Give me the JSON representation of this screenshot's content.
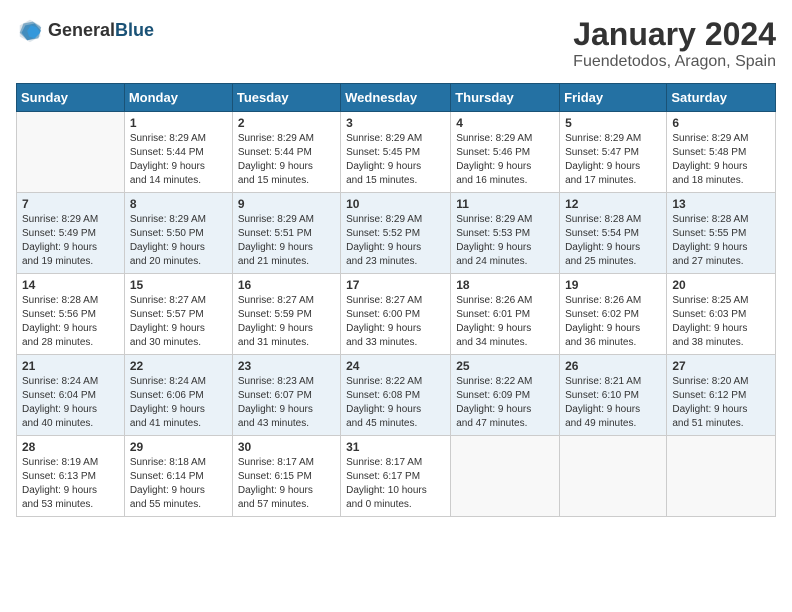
{
  "header": {
    "logo_general": "General",
    "logo_blue": "Blue",
    "title": "January 2024",
    "subtitle": "Fuendetodos, Aragon, Spain"
  },
  "calendar": {
    "days_of_week": [
      "Sunday",
      "Monday",
      "Tuesday",
      "Wednesday",
      "Thursday",
      "Friday",
      "Saturday"
    ],
    "weeks": [
      [
        {
          "day": "",
          "info": ""
        },
        {
          "day": "1",
          "info": "Sunrise: 8:29 AM\nSunset: 5:44 PM\nDaylight: 9 hours\nand 14 minutes."
        },
        {
          "day": "2",
          "info": "Sunrise: 8:29 AM\nSunset: 5:44 PM\nDaylight: 9 hours\nand 15 minutes."
        },
        {
          "day": "3",
          "info": "Sunrise: 8:29 AM\nSunset: 5:45 PM\nDaylight: 9 hours\nand 15 minutes."
        },
        {
          "day": "4",
          "info": "Sunrise: 8:29 AM\nSunset: 5:46 PM\nDaylight: 9 hours\nand 16 minutes."
        },
        {
          "day": "5",
          "info": "Sunrise: 8:29 AM\nSunset: 5:47 PM\nDaylight: 9 hours\nand 17 minutes."
        },
        {
          "day": "6",
          "info": "Sunrise: 8:29 AM\nSunset: 5:48 PM\nDaylight: 9 hours\nand 18 minutes."
        }
      ],
      [
        {
          "day": "7",
          "info": "Sunrise: 8:29 AM\nSunset: 5:49 PM\nDaylight: 9 hours\nand 19 minutes."
        },
        {
          "day": "8",
          "info": "Sunrise: 8:29 AM\nSunset: 5:50 PM\nDaylight: 9 hours\nand 20 minutes."
        },
        {
          "day": "9",
          "info": "Sunrise: 8:29 AM\nSunset: 5:51 PM\nDaylight: 9 hours\nand 21 minutes."
        },
        {
          "day": "10",
          "info": "Sunrise: 8:29 AM\nSunset: 5:52 PM\nDaylight: 9 hours\nand 23 minutes."
        },
        {
          "day": "11",
          "info": "Sunrise: 8:29 AM\nSunset: 5:53 PM\nDaylight: 9 hours\nand 24 minutes."
        },
        {
          "day": "12",
          "info": "Sunrise: 8:28 AM\nSunset: 5:54 PM\nDaylight: 9 hours\nand 25 minutes."
        },
        {
          "day": "13",
          "info": "Sunrise: 8:28 AM\nSunset: 5:55 PM\nDaylight: 9 hours\nand 27 minutes."
        }
      ],
      [
        {
          "day": "14",
          "info": "Sunrise: 8:28 AM\nSunset: 5:56 PM\nDaylight: 9 hours\nand 28 minutes."
        },
        {
          "day": "15",
          "info": "Sunrise: 8:27 AM\nSunset: 5:57 PM\nDaylight: 9 hours\nand 30 minutes."
        },
        {
          "day": "16",
          "info": "Sunrise: 8:27 AM\nSunset: 5:59 PM\nDaylight: 9 hours\nand 31 minutes."
        },
        {
          "day": "17",
          "info": "Sunrise: 8:27 AM\nSunset: 6:00 PM\nDaylight: 9 hours\nand 33 minutes."
        },
        {
          "day": "18",
          "info": "Sunrise: 8:26 AM\nSunset: 6:01 PM\nDaylight: 9 hours\nand 34 minutes."
        },
        {
          "day": "19",
          "info": "Sunrise: 8:26 AM\nSunset: 6:02 PM\nDaylight: 9 hours\nand 36 minutes."
        },
        {
          "day": "20",
          "info": "Sunrise: 8:25 AM\nSunset: 6:03 PM\nDaylight: 9 hours\nand 38 minutes."
        }
      ],
      [
        {
          "day": "21",
          "info": "Sunrise: 8:24 AM\nSunset: 6:04 PM\nDaylight: 9 hours\nand 40 minutes."
        },
        {
          "day": "22",
          "info": "Sunrise: 8:24 AM\nSunset: 6:06 PM\nDaylight: 9 hours\nand 41 minutes."
        },
        {
          "day": "23",
          "info": "Sunrise: 8:23 AM\nSunset: 6:07 PM\nDaylight: 9 hours\nand 43 minutes."
        },
        {
          "day": "24",
          "info": "Sunrise: 8:22 AM\nSunset: 6:08 PM\nDaylight: 9 hours\nand 45 minutes."
        },
        {
          "day": "25",
          "info": "Sunrise: 8:22 AM\nSunset: 6:09 PM\nDaylight: 9 hours\nand 47 minutes."
        },
        {
          "day": "26",
          "info": "Sunrise: 8:21 AM\nSunset: 6:10 PM\nDaylight: 9 hours\nand 49 minutes."
        },
        {
          "day": "27",
          "info": "Sunrise: 8:20 AM\nSunset: 6:12 PM\nDaylight: 9 hours\nand 51 minutes."
        }
      ],
      [
        {
          "day": "28",
          "info": "Sunrise: 8:19 AM\nSunset: 6:13 PM\nDaylight: 9 hours\nand 53 minutes."
        },
        {
          "day": "29",
          "info": "Sunrise: 8:18 AM\nSunset: 6:14 PM\nDaylight: 9 hours\nand 55 minutes."
        },
        {
          "day": "30",
          "info": "Sunrise: 8:17 AM\nSunset: 6:15 PM\nDaylight: 9 hours\nand 57 minutes."
        },
        {
          "day": "31",
          "info": "Sunrise: 8:17 AM\nSunset: 6:17 PM\nDaylight: 10 hours\nand 0 minutes."
        },
        {
          "day": "",
          "info": ""
        },
        {
          "day": "",
          "info": ""
        },
        {
          "day": "",
          "info": ""
        }
      ]
    ]
  }
}
